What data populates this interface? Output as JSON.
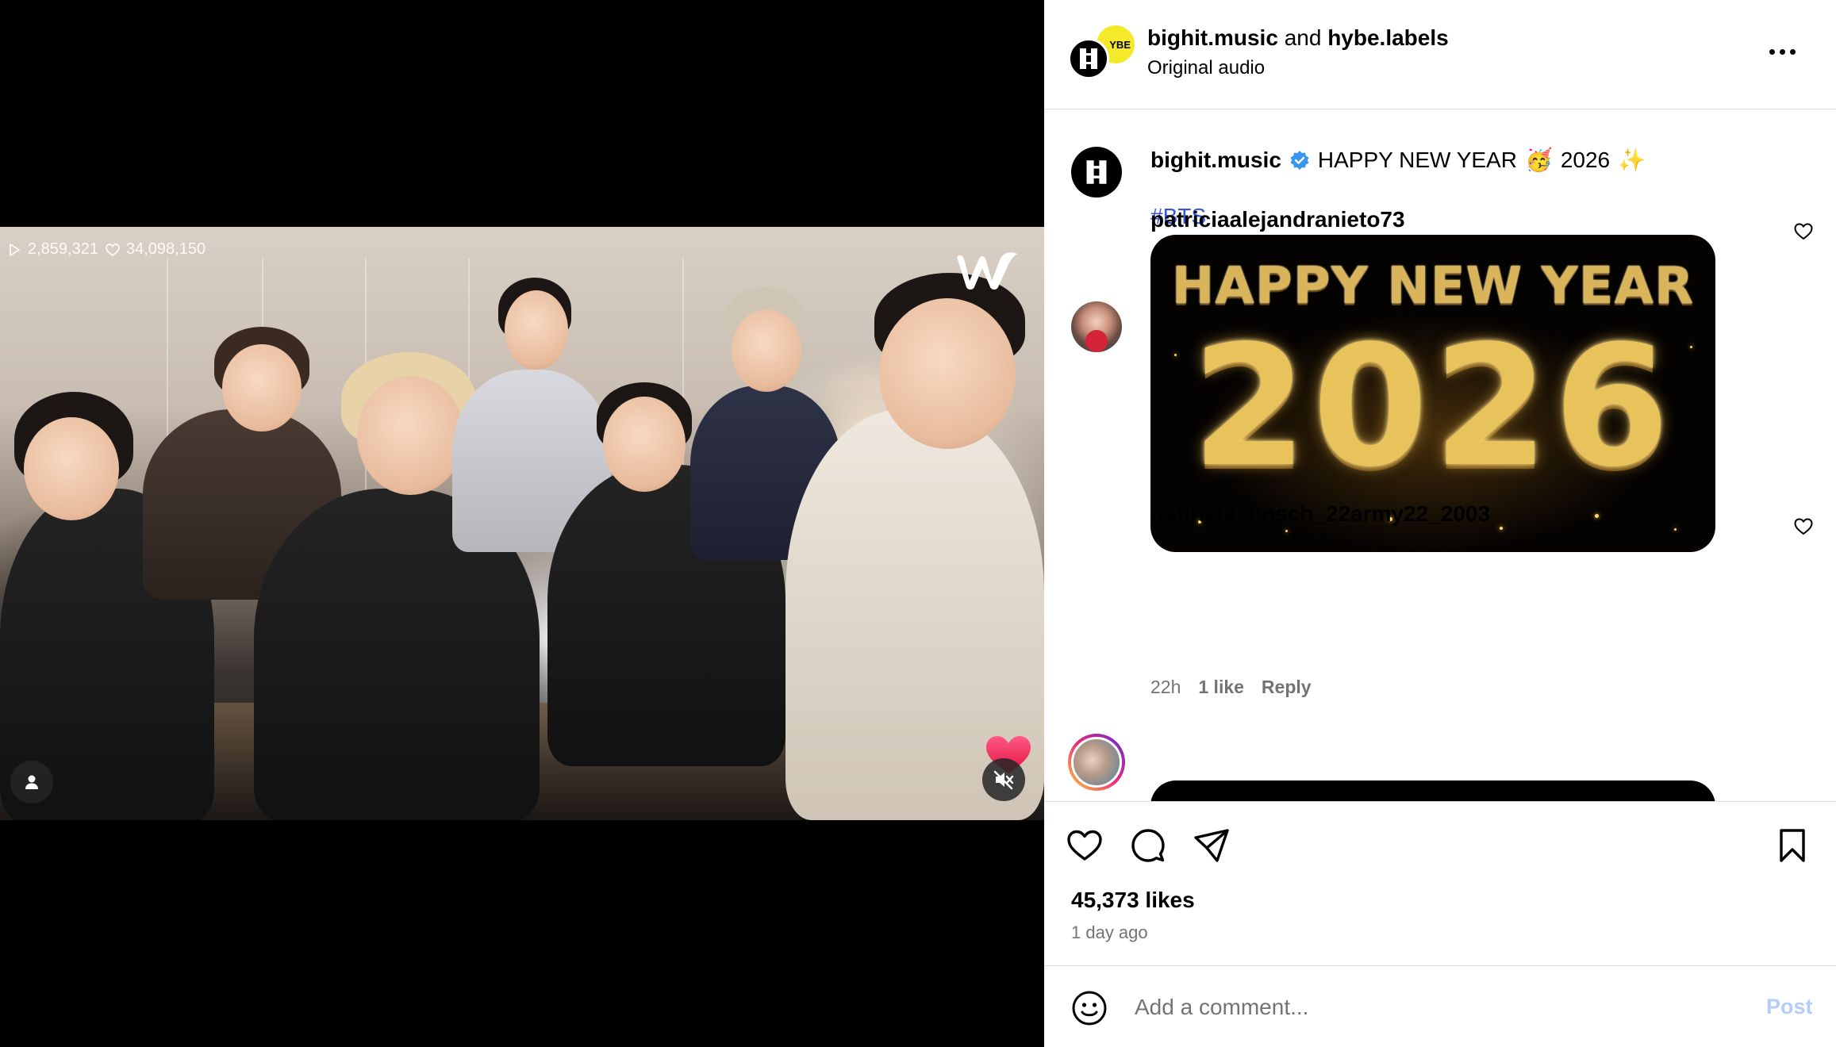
{
  "media": {
    "plays": "2,859,321",
    "hearts": "34,098,150",
    "watermark": "w"
  },
  "header": {
    "account_1": "bighit.music",
    "joiner": "and",
    "account_2": "hybe.labels",
    "audio": "Original audio",
    "hybe_badge": "YBE"
  },
  "caption": {
    "user": "bighit.music",
    "text_1": "HAPPY NEW YEAR",
    "emoji_1": "🥳",
    "text_2": "2026",
    "emoji_2": "✨",
    "hashtag": "#BTS",
    "time": "1d"
  },
  "comments": [
    {
      "user": "patriciaalejandranieto73",
      "gif_title": "HAPPY NEW YEAR",
      "gif_year": "2026",
      "time": "22h",
      "likes": "1 like",
      "reply": "Reply"
    },
    {
      "user": "gabriela_bosch_22army22_2003"
    }
  ],
  "actions": {
    "likes": "45,373 likes",
    "ago": "1 day ago"
  },
  "comment_bar": {
    "placeholder": "Add a comment...",
    "post_label": "Post"
  },
  "colors": {
    "link_blue": "#3955d6",
    "post_disabled": "#b3cdf7",
    "verified": "#3797f0",
    "hybe_yellow": "#f4ea2a",
    "muted_text": "#737373"
  },
  "icons": [
    "play-icon",
    "heart-outline-icon",
    "weverse-logo",
    "user-tag-icon",
    "mute-icon",
    "heart-float-icon",
    "more-icon",
    "verified-badge-icon",
    "like-icon",
    "comment-icon",
    "share-icon",
    "save-icon",
    "emoji-icon"
  ]
}
